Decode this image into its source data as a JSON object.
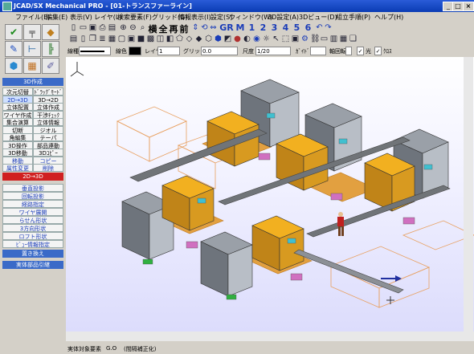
{
  "window": {
    "title": "JCAD/SX Mechanical PRO - [01-トランスファーライン]",
    "controls": [
      "_",
      "□",
      "×"
    ]
  },
  "menu": [
    "ファイル(E)",
    "編集(E)",
    "表示(V)",
    "レイヤ(L)",
    "検索要素(F)",
    "グリッド(G)",
    "情報表示(I)",
    "設定(S)",
    "ウィンドウ(W)",
    "3D設定(A)",
    "3Dビュー(D)",
    "組立手順(P)",
    "ヘルプ(H)"
  ],
  "toolbar": {
    "kanji": [
      "横",
      "全",
      "再",
      "前"
    ],
    "gr": "GR",
    "m": "M",
    "numbers": [
      "1",
      "2",
      "3",
      "4",
      "5",
      "6"
    ]
  },
  "properties": {
    "line_type_label": "線種",
    "color_label": "線色",
    "layer_label": "レイヤ",
    "layer_value": "1",
    "grid_label": "グリッド",
    "grid_value": "0.0",
    "scale_label": "尺度",
    "scale_value": "1/20",
    "pitch_label": "ｶﾞｲﾄﾞ",
    "axis_label": "軸回転",
    "light_label": "光",
    "shadow_label": "ｸﾛｽ"
  },
  "palette": {
    "header": "3D作成",
    "rows": [
      [
        "次元切替",
        "ﾄﾞﾗｯｸﾞﾓｰﾄﾞ"
      ],
      [
        "2D→3D",
        "3D→2D"
      ],
      [
        "立体配置",
        "立体作成"
      ],
      [
        "ワイヤ作成",
        "干渉ﾁｪｯｸ"
      ],
      [
        "集合演算",
        "立体情報"
      ],
      [
        "切断",
        "ジオル"
      ],
      [
        "角編集",
        "テーパ"
      ],
      [
        "3D操作",
        "部品連動"
      ],
      [
        "3D移動",
        "3Dｺﾋﾟｰ"
      ],
      [
        "移動",
        "コピー"
      ],
      [
        "属性変更",
        "削除"
      ]
    ],
    "convert_label": "2D→3D",
    "items": [
      "垂直投影",
      "回転投影",
      "経路指定",
      "ワイヤ展開",
      "らせん形状",
      "3方向形状",
      "ロフト形状",
      "ﾋﾞｭｰ情報指定"
    ],
    "replace_label": "置き換え",
    "parts_ref_label": "実体部品引継"
  },
  "status": {
    "item1": "実体対象要素",
    "item2": "G.O",
    "item3": "(間隔補正化)"
  },
  "accent": {
    "title": "#0a3cb4",
    "header": "#3a6ac8",
    "palette_red": "#d02020"
  }
}
